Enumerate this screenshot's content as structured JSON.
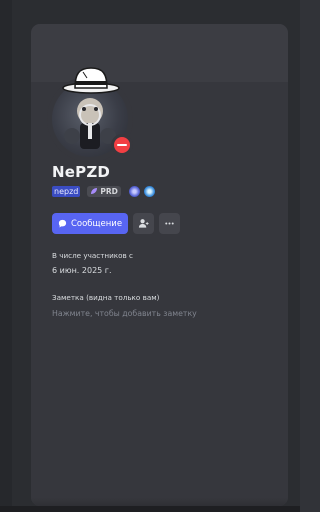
{
  "profile": {
    "display_name": "NePZD",
    "username": "nepzd",
    "clan_tag": "PRD",
    "status": "do-not-disturb",
    "badges": [
      "nitro-badge-icon",
      "boost-badge-icon"
    ]
  },
  "actions": {
    "message_label": "Сообщение",
    "add_friend_icon": "person-add-icon",
    "more_icon": "more-horizontal-icon"
  },
  "member_since": {
    "label": "В числе участников с",
    "value": "6 июн. 2025 г."
  },
  "note": {
    "label": "Заметка (видна только вам)",
    "placeholder": "Нажмите, чтобы добавить заметку"
  },
  "colors": {
    "accent": "#5865f2",
    "status_dnd": "#f23f43",
    "username_highlight": "#3a4cc2"
  }
}
